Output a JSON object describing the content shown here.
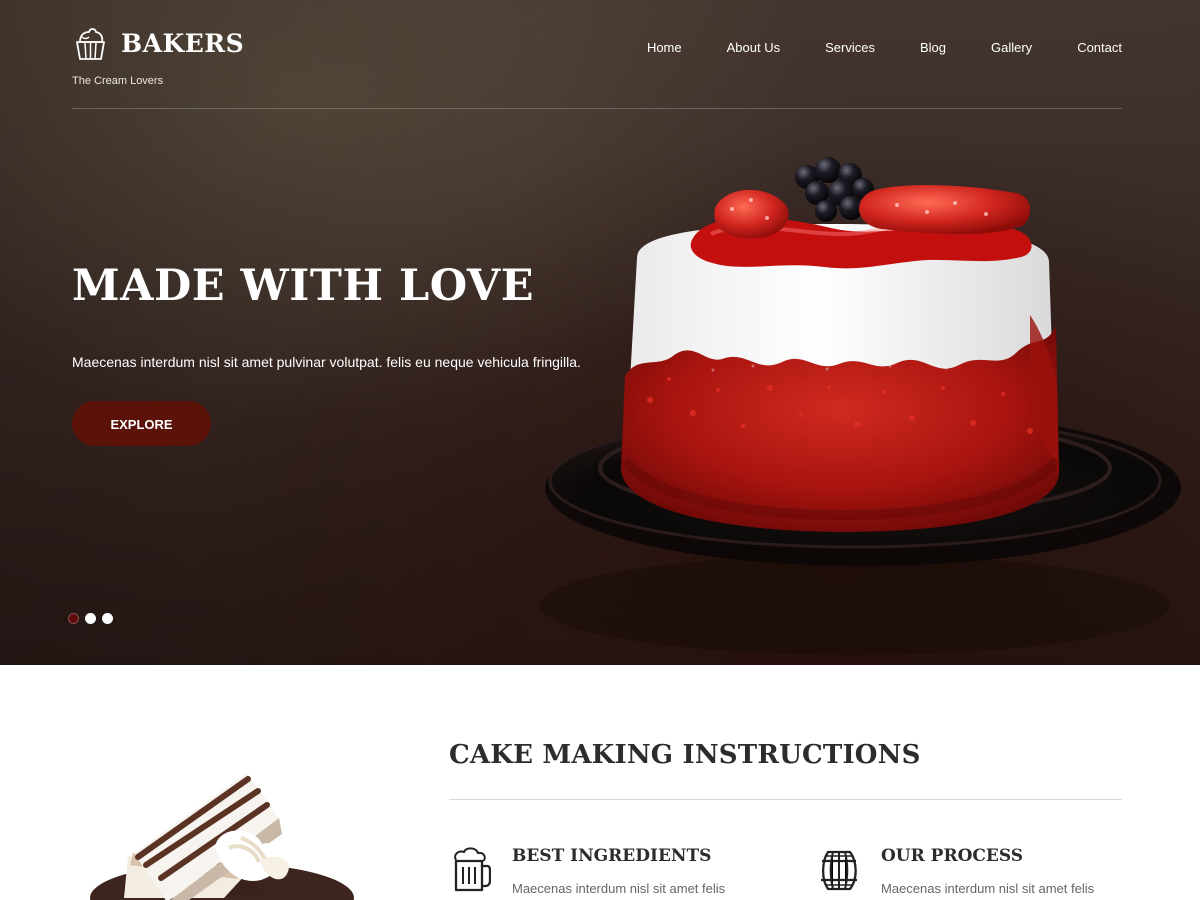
{
  "brand": {
    "name": "BAKERS",
    "tagline": "The Cream Lovers",
    "icon": "cupcake-icon"
  },
  "nav": {
    "items": [
      {
        "label": "Home"
      },
      {
        "label": "About Us"
      },
      {
        "label": "Services"
      },
      {
        "label": "Blog"
      },
      {
        "label": "Gallery"
      },
      {
        "label": "Contact"
      }
    ]
  },
  "hero": {
    "title": "MADE WITH LOVE",
    "subtitle": "Maecenas interdum nisl sit amet pulvinar volutpat. felis eu neque vehicula fringilla.",
    "button_label": "EXPLORE",
    "slides": {
      "active_index": 0,
      "count": 3
    },
    "colors": {
      "accent": "#5b1209"
    }
  },
  "content": {
    "section_title": "CAKE MAKING INSTRUCTIONS",
    "features": [
      {
        "title": "BEST INGREDIENTS",
        "text": "Maecenas interdum nisl sit amet felis",
        "icon": "beer-mug-icon"
      },
      {
        "title": "OUR PROCESS",
        "text": "Maecenas interdum nisl sit amet felis",
        "icon": "barrel-icon"
      }
    ]
  }
}
